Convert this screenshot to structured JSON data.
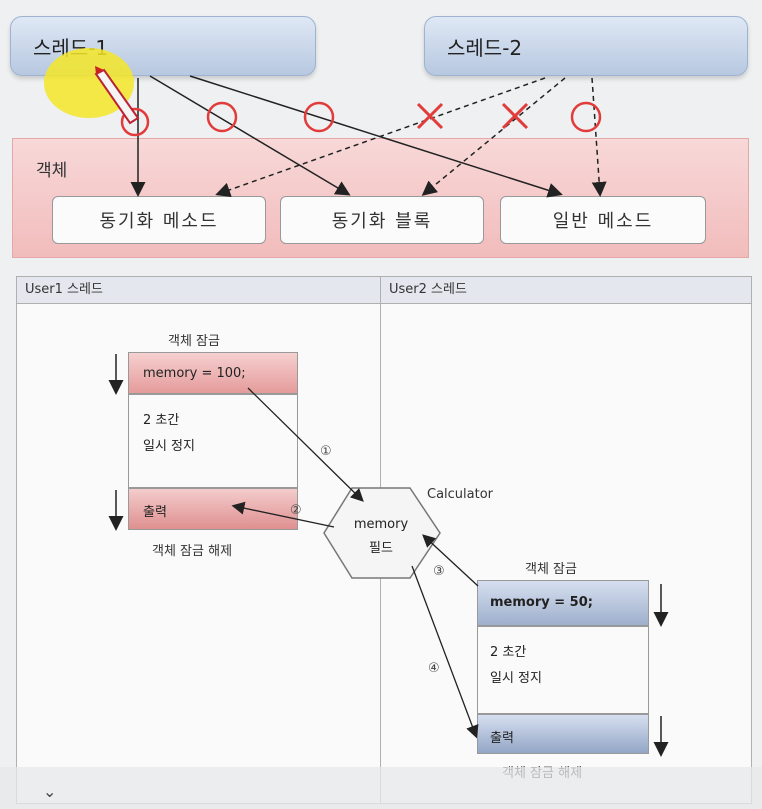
{
  "threads": {
    "thread1": "스레드-1",
    "thread2": "스레드-2"
  },
  "object_panel": {
    "label": "객체",
    "methods": [
      "동기화 메소드",
      "동기화 블록",
      "일반 메소드"
    ]
  },
  "access_marks": [
    "O",
    "O",
    "O",
    "X",
    "X",
    "O"
  ],
  "user1": {
    "header": "User1 스레드",
    "lock_label": "객체 잠금",
    "lock_code": "memory = 100;",
    "pause_line1": "2 초간",
    "pause_line2": "일시 정지",
    "output": "출력",
    "unlock_label": "객체 잠금 해제"
  },
  "user2": {
    "header": "User2 스레드",
    "lock_label": "객체 잠금",
    "lock_code": "memory = 50;",
    "pause_line1": "2 초간",
    "pause_line2": "일시 정지",
    "output": "출력",
    "unlock_label": "객체 잠금 해제"
  },
  "calculator": {
    "title": "Calculator",
    "field_line1": "memory",
    "field_line2": "필드"
  },
  "steps": [
    "①",
    "②",
    "③",
    "④"
  ],
  "colors": {
    "thread_box": "#b7c8e0",
    "object_panel": "#f2bcbc",
    "o_mark": "#e23b3b",
    "x_mark": "#e23b3b",
    "user1_accent": "#e59b9b",
    "user2_accent": "#9fb0cc"
  },
  "icons": {
    "pen": "pencil-icon",
    "collapse": "chevron-down-icon"
  }
}
